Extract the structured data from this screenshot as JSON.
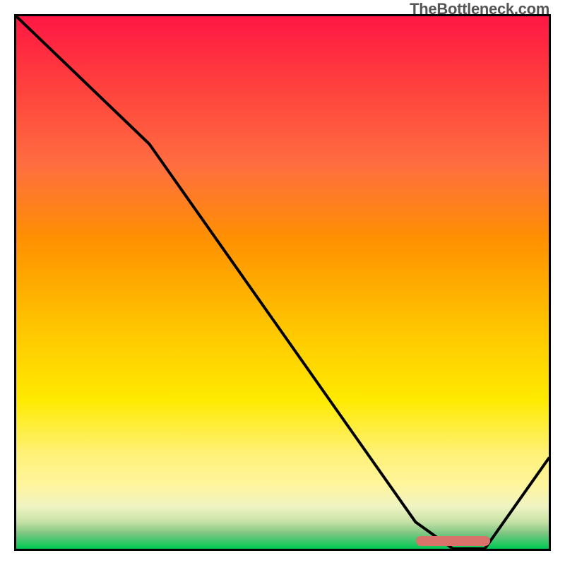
{
  "watermark": "TheBottleneck.com",
  "chart_data": {
    "type": "line",
    "title": "",
    "xlabel": "",
    "ylabel": "",
    "xlim": [
      0,
      100
    ],
    "ylim": [
      0,
      100
    ],
    "series": [
      {
        "name": "bottleneck-curve",
        "x": [
          0,
          25,
          75,
          82,
          88,
          100
        ],
        "y": [
          100,
          76,
          5,
          0,
          0,
          17
        ]
      }
    ],
    "optimal_marker": {
      "x_start": 75,
      "x_end": 89,
      "y": 1.5
    },
    "gradient_stops": [
      {
        "pos": 0,
        "color": "#ff1744"
      },
      {
        "pos": 12,
        "color": "#ff3d3d"
      },
      {
        "pos": 28,
        "color": "#ff6e40"
      },
      {
        "pos": 42,
        "color": "#ff9100"
      },
      {
        "pos": 58,
        "color": "#ffc400"
      },
      {
        "pos": 72,
        "color": "#ffea00"
      },
      {
        "pos": 82,
        "color": "#fff176"
      },
      {
        "pos": 88,
        "color": "#fff59d"
      },
      {
        "pos": 92,
        "color": "#f0f4c3"
      },
      {
        "pos": 95,
        "color": "#c5e1a5"
      },
      {
        "pos": 97,
        "color": "#81c784"
      },
      {
        "pos": 100,
        "color": "#00c853"
      }
    ]
  }
}
